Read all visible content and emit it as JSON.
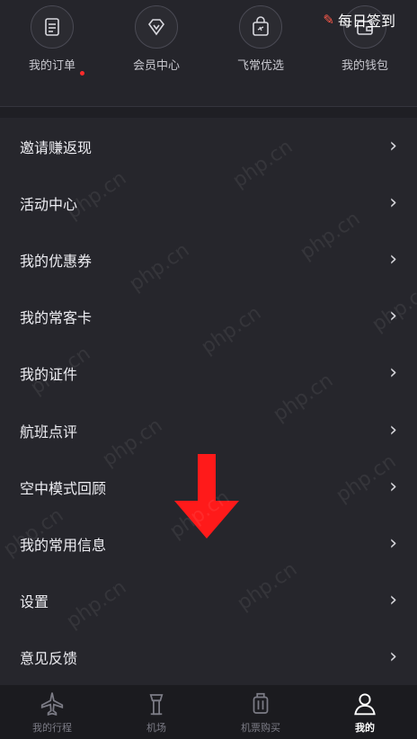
{
  "header": {
    "checkin_label": "每日签到",
    "quick_links": [
      {
        "label": "我的订单",
        "icon": "order-icon"
      },
      {
        "label": "会员中心",
        "icon": "diamond-icon"
      },
      {
        "label": "飞常优选",
        "icon": "shopping-bag-icon"
      },
      {
        "label": "我的钱包",
        "icon": "wallet-icon"
      }
    ]
  },
  "menu": {
    "items": [
      {
        "label": "邀请赚返现"
      },
      {
        "label": "活动中心"
      },
      {
        "label": "我的优惠券"
      },
      {
        "label": "我的常客卡"
      },
      {
        "label": "我的证件"
      },
      {
        "label": "航班点评"
      },
      {
        "label": "空中模式回顾"
      },
      {
        "label": "我的常用信息"
      },
      {
        "label": "设置"
      },
      {
        "label": "意见反馈"
      }
    ]
  },
  "tabbar": {
    "tabs": [
      {
        "label": "我的行程",
        "icon": "airplane-icon",
        "active": false
      },
      {
        "label": "机场",
        "icon": "control-tower-icon",
        "active": false
      },
      {
        "label": "机票购买",
        "icon": "luggage-icon",
        "active": false
      },
      {
        "label": "我的",
        "icon": "person-icon",
        "active": true
      }
    ]
  },
  "watermark": "php.cn",
  "colors": {
    "background": "#26262c",
    "accent_red": "#ff2b2b",
    "tab_active": "#ffffff"
  }
}
